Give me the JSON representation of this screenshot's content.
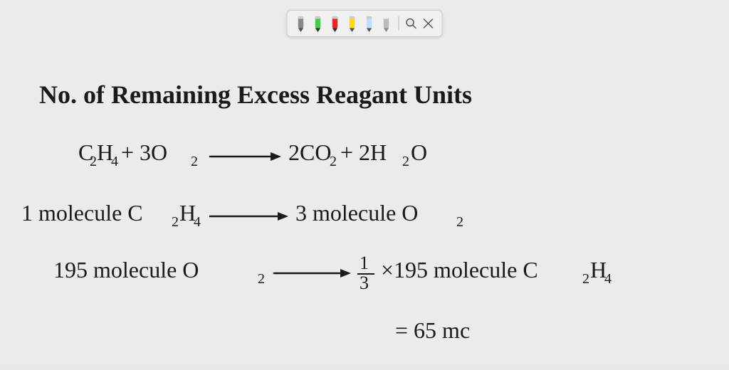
{
  "toolbar": {
    "tools": [
      {
        "name": "pencil-gray",
        "color": "#888888",
        "label": "Gray pencil"
      },
      {
        "name": "pencil-green",
        "color": "#44cc44",
        "label": "Green pencil"
      },
      {
        "name": "pencil-red",
        "color": "#ee2222",
        "label": "Red pencil"
      },
      {
        "name": "pencil-yellow",
        "color": "#ffdd00",
        "label": "Yellow pencil"
      },
      {
        "name": "pencil-light-blue",
        "color": "#aaddff",
        "label": "Light blue pencil"
      },
      {
        "name": "pencil-gray2",
        "color": "#aaaaaa",
        "label": "Gray pencil 2"
      }
    ],
    "search_label": "Search",
    "close_label": "Close"
  },
  "content": {
    "title": "No. of Remaining Excess Reagant Units",
    "equation": "C₂H₄ + 3O₂ → 2CO₂ + 2H₂O",
    "line1": "1 molecule C₂H₄ → 3 molecule O₂",
    "line2": "195 molecule O₂ → 1/3 × 195 molecule C₂H₄",
    "line3": "= 65 mc"
  }
}
